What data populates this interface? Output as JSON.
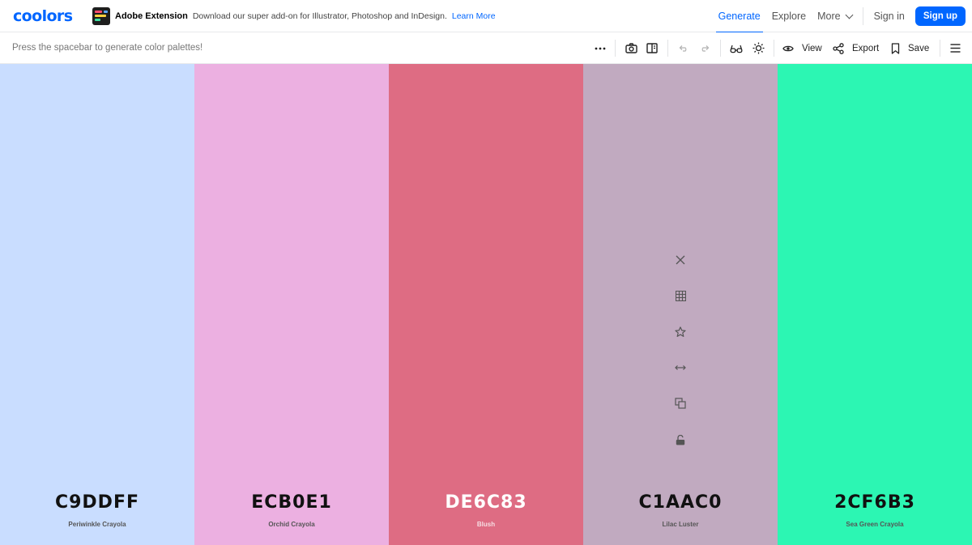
{
  "header": {
    "logo": "coolors",
    "adobe": {
      "title": "Adobe Extension",
      "description": "Download our super add-on for Illustrator, Photoshop and InDesign.",
      "link": "Learn More"
    },
    "nav": {
      "generate": "Generate",
      "explore": "Explore",
      "more": "More",
      "signin": "Sign in",
      "signup": "Sign up"
    },
    "accent": "#0066ff"
  },
  "toolbar": {
    "hint": "Press the spacebar to generate color palettes!",
    "view_label": "View",
    "export_label": "Export",
    "save_label": "Save",
    "icons": [
      "more-icon",
      "camera-icon",
      "layout-icon",
      "undo-icon",
      "redo-icon",
      "glasses-icon",
      "sun-icon",
      "eye-icon",
      "share-icon",
      "bookmark-icon",
      "menu-icon"
    ]
  },
  "palette": {
    "swatches": [
      {
        "hex": "C9DDFF",
        "name": "Periwinkle Crayola",
        "color": "#C9DDFF",
        "text_color": "#111111",
        "name_color": "#555555"
      },
      {
        "hex": "ECB0E1",
        "name": "Orchid Crayola",
        "color": "#ECB0E1",
        "text_color": "#111111",
        "name_color": "#555555"
      },
      {
        "hex": "DE6C83",
        "name": "Blush",
        "color": "#DE6C83",
        "text_color": "#ffffff",
        "name_color": "#f6dce2"
      },
      {
        "hex": "C1AAC0",
        "name": "Lilac Luster",
        "color": "#C1AAC0",
        "text_color": "#111111",
        "name_color": "#555555"
      },
      {
        "hex": "2CF6B3",
        "name": "Sea Green Crayola",
        "color": "#2CF6B3",
        "text_color": "#111111",
        "name_color": "#555555"
      }
    ],
    "active_swatch_tools": [
      "close-icon",
      "grid-icon",
      "star-icon",
      "drag-icon",
      "copy-icon",
      "lock-icon"
    ]
  }
}
